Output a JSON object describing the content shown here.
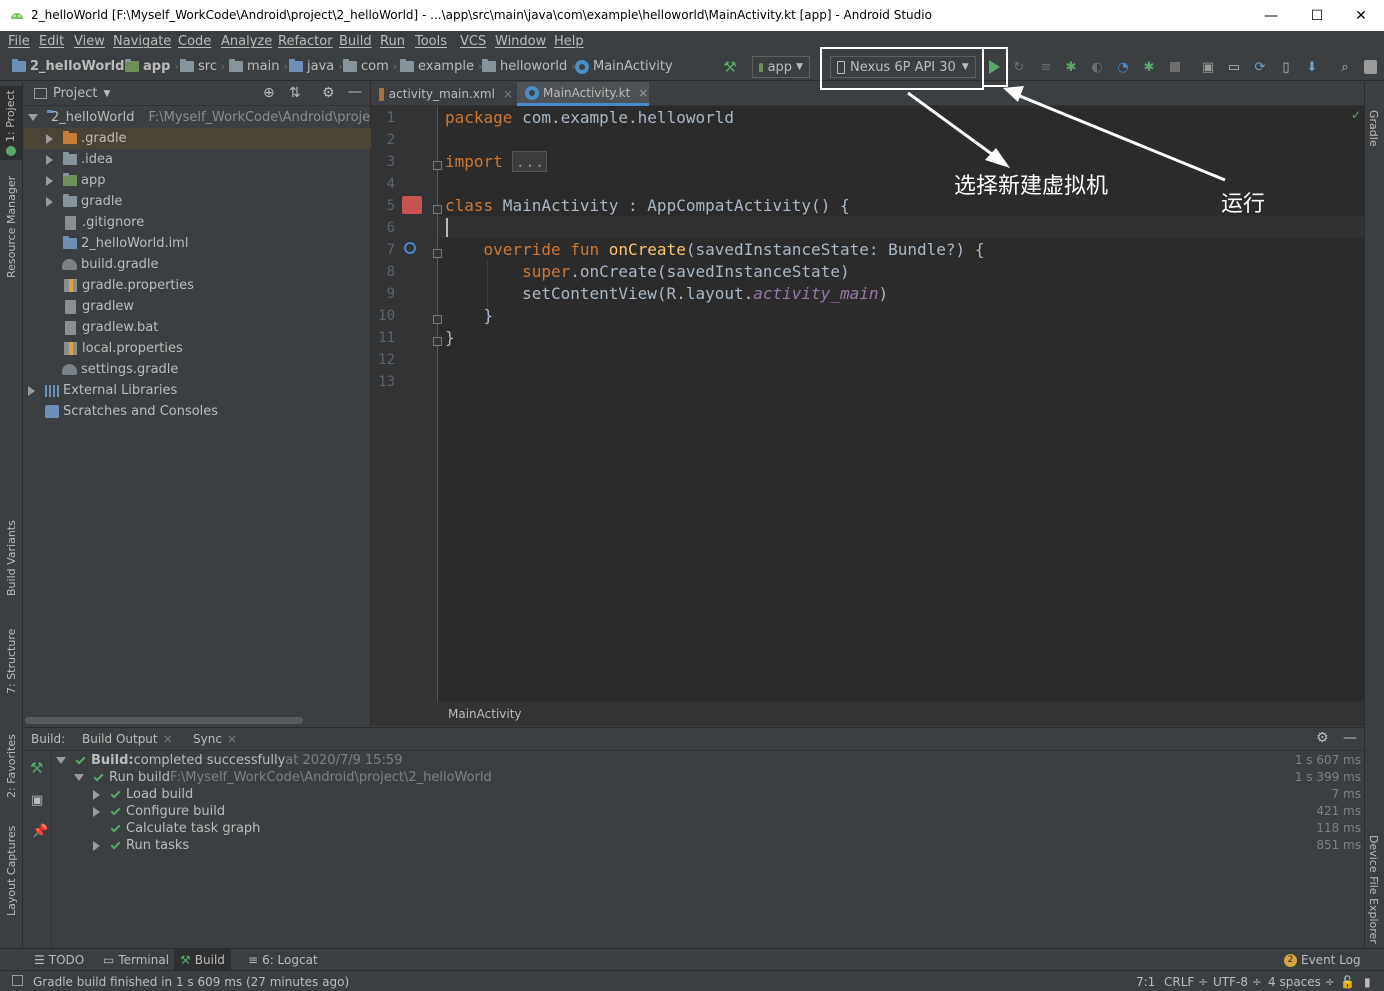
{
  "window": {
    "title": "2_helloWorld [F:\\Myself_WorkCode\\Android\\project\\2_helloWorld] - ...\\app\\src\\main\\java\\com\\example\\helloworld\\MainActivity.kt [app] - Android Studio",
    "minimize": "—",
    "maximize": "☐",
    "close": "✕"
  },
  "menu": [
    "File",
    "Edit",
    "View",
    "Navigate",
    "Code",
    "Analyze",
    "Refactor",
    "Build",
    "Run",
    "Tools",
    "VCS",
    "Window",
    "Help"
  ],
  "breadcrumbs": [
    "2_helloWorld",
    "app",
    "src",
    "main",
    "java",
    "com",
    "example",
    "helloworld",
    "MainActivity"
  ],
  "toolbar": {
    "run_config": "app",
    "device": "Nexus 6P API 30"
  },
  "left_stripe": {
    "project": "1: Project",
    "resource_manager": "Resource Manager",
    "build_variants": "Build Variants",
    "structure": "7: Structure",
    "favorites": "2: Favorites",
    "layout_captures": "Layout Captures"
  },
  "right_stripe": {
    "gradle": "Gradle",
    "device_file_explorer": "Device File Explorer"
  },
  "project_panel": {
    "header": "Project",
    "root_name": "2_helloWorld",
    "root_path": "F:\\Myself_WorkCode\\Android\\project\\",
    "items": [
      ".gradle",
      ".idea",
      "app",
      "gradle",
      ".gitignore",
      "2_helloWorld.iml",
      "build.gradle",
      "gradle.properties",
      "gradlew",
      "gradlew.bat",
      "local.properties",
      "settings.gradle"
    ],
    "external_libraries": "External Libraries",
    "scratches": "Scratches and Consoles"
  },
  "editor_tabs": [
    "activity_main.xml",
    "MainActivity.kt"
  ],
  "editor": {
    "line_numbers": [
      "1",
      "2",
      "3",
      "4",
      "5",
      "6",
      "7",
      "8",
      "9",
      "10",
      "11",
      "12",
      "13"
    ],
    "l1_kw": "package",
    "l1_rest": " com.example.helloworld",
    "l3_kw": "import",
    "l3_fold": "...",
    "l6_kw": "class",
    "l6_rest": " MainActivity : AppCompatActivity() {",
    "l8_kw": "override fun",
    "l8_fn": "onCreate",
    "l8_rest": "(savedInstanceState: Bundle?) {",
    "l9_kw": "super",
    "l9_rest": ".onCreate(savedInstanceState)",
    "l10_pre": "setContentView(R.layout.",
    "l10_it": "activity_main",
    "l10_post": ")",
    "l11": "}",
    "l12": "}",
    "breadcrumb": "MainActivity"
  },
  "build_window": {
    "title": "Build:",
    "tabs": [
      "Build Output",
      "Sync"
    ],
    "rows": [
      {
        "bold": "Build:",
        "text": " completed successfully",
        "dim": " at 2020/7/9 15:59",
        "time": "1 s 607 ms"
      },
      {
        "bold": "",
        "text": "Run build",
        "dim": " F:\\Myself_WorkCode\\Android\\project\\2_helloWorld",
        "time": "1 s 399 ms"
      },
      {
        "bold": "",
        "text": "Load build",
        "dim": "",
        "time": "7 ms"
      },
      {
        "bold": "",
        "text": "Configure build",
        "dim": "",
        "time": "421 ms"
      },
      {
        "bold": "",
        "text": "Calculate task graph",
        "dim": "",
        "time": "118 ms"
      },
      {
        "bold": "",
        "text": "Run tasks",
        "dim": "",
        "time": "851 ms"
      }
    ]
  },
  "bottom_tabs": {
    "todo": "TODO",
    "terminal": "Terminal",
    "build": "Build",
    "logcat": "6: Logcat",
    "event_log": "Event Log",
    "event_count": "2"
  },
  "status": {
    "message": "Gradle build finished in 1 s 609 ms (27 minutes ago)",
    "position": "7:1",
    "line_sep": "CRLF ÷",
    "encoding": "UTF-8 ÷",
    "indent": "4 spaces ÷"
  },
  "annotations": {
    "new_vm": "选择新建虚拟机",
    "run": "运行"
  },
  "colors": {
    "keyword": "#cc7832",
    "function": "#ffc66d",
    "field": "#9876aa",
    "success": "#59a869",
    "accent": "#4a88c7"
  }
}
